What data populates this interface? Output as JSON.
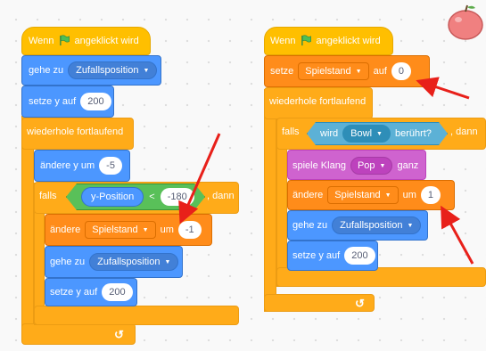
{
  "left_script": {
    "hat_label": "Wenn",
    "hat_suffix": "angeklickt wird",
    "goto_label": "gehe zu",
    "goto_target": "Zufallsposition",
    "sety_label": "setze y auf",
    "sety_value": "200",
    "forever_label": "wiederhole fortlaufend",
    "changey_label": "ändere y um",
    "changey_value": "-5",
    "if_label": "falls",
    "ypos_label": "y-Position",
    "lt_op": "<",
    "lt_value": "-180",
    "then_label": ", dann",
    "change_var_label": "ändere",
    "change_var_name": "Spielstand",
    "change_var_by": "um",
    "change_var_value": "-1",
    "goto2_label": "gehe zu",
    "goto2_target": "Zufallsposition",
    "sety2_label": "setze y auf",
    "sety2_value": "200"
  },
  "right_script": {
    "hat_label": "Wenn",
    "hat_suffix": "angeklickt wird",
    "set_label": "setze",
    "set_var": "Spielstand",
    "set_to": "auf",
    "set_value": "0",
    "forever_label": "wiederhole fortlaufend",
    "if_label": "falls",
    "touch_label": "wird",
    "touch_target": "Bowl",
    "touch_suffix": "berührt?",
    "then_label": ", dann",
    "sound_label": "spiele Klang",
    "sound_name": "Pop",
    "sound_suffix": "ganz",
    "change_label": "ändere",
    "change_var": "Spielstand",
    "change_by": "um",
    "change_value": "1",
    "goto_label": "gehe zu",
    "goto_target": "Zufallsposition",
    "sety_label": "setze y auf",
    "sety_value": "200"
  },
  "colors": {
    "events": "#ffbf00",
    "control": "#ffab19",
    "motion": "#4c97ff",
    "variables": "#ff8c1a",
    "sound": "#cf63cf",
    "sensing": "#5cb1d6",
    "operators": "#59c059",
    "flag": "#4cbf56",
    "annotation_arrow": "#e8201a"
  },
  "icons": {
    "flag": "green-flag-icon",
    "dropdown": "dropdown-arrow-icon",
    "loop": "loop-arrow-icon",
    "sprite": "apple-sprite-icon"
  }
}
